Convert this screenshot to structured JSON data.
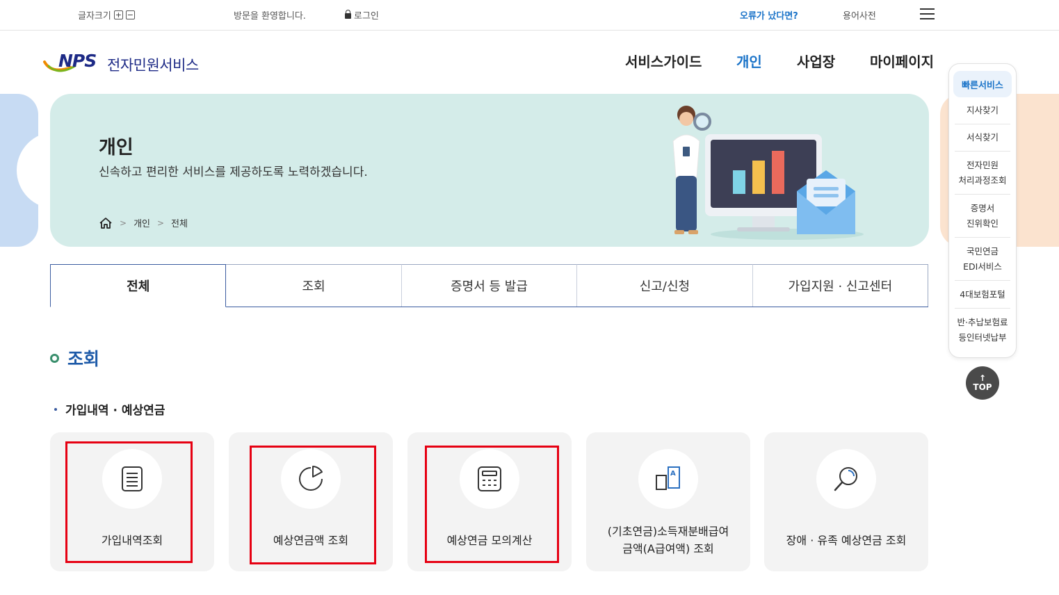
{
  "topbar": {
    "font_size_label": "글자크기",
    "font_plus": "+",
    "font_minus": "−",
    "welcome": "방문을 환영합니다.",
    "login": "로그인",
    "error_report": "오류가 났다면?",
    "glossary": "용어사전"
  },
  "header": {
    "logo_mark": "NPS",
    "logo_text": "전자민원서비스",
    "nav": [
      "서비스가이드",
      "개인",
      "사업장",
      "마이페이지"
    ],
    "active_nav": "개인"
  },
  "banner": {
    "title": "개인",
    "subtitle": "신속하고 편리한 서비스를 제공하도록 노력하겠습니다.",
    "breadcrumb": [
      "개인",
      "전체"
    ]
  },
  "tabs": [
    "전체",
    "조회",
    "증명서 등 발급",
    "신고/신청",
    "가입지원 · 신고센터"
  ],
  "active_tab": "전체",
  "section": {
    "title": "조회",
    "subtitle": "가입내역 · 예상연금"
  },
  "cards": [
    {
      "label": "가입내역조회",
      "icon": "document-icon"
    },
    {
      "label": "예상연금액 조회",
      "icon": "pie-chart-icon"
    },
    {
      "label": "예상연금 모의계산",
      "icon": "calculator-icon"
    },
    {
      "label": "(기초연금)소득재분배급여",
      "label2": "금액(A급여액) 조회",
      "icon": "a-benefit-icon"
    },
    {
      "label": "장애 · 유족 예상연금 조회",
      "icon": "magnifier-icon"
    }
  ],
  "quick_menu": {
    "title": "빠른서비스",
    "items": [
      "지사찾기",
      "서식찾기",
      "전자민원\n처리과정조회",
      "증명서\n진위확인",
      "국민연금\nEDI서비스",
      "4대보험포털",
      "반·추납보험료\n등인터넷납부"
    ]
  },
  "top_button": "TOP",
  "colors": {
    "brand": "#1d2a86",
    "accent": "#1a73c8",
    "banner": "#d4ece9",
    "highlight": "#e60012"
  }
}
